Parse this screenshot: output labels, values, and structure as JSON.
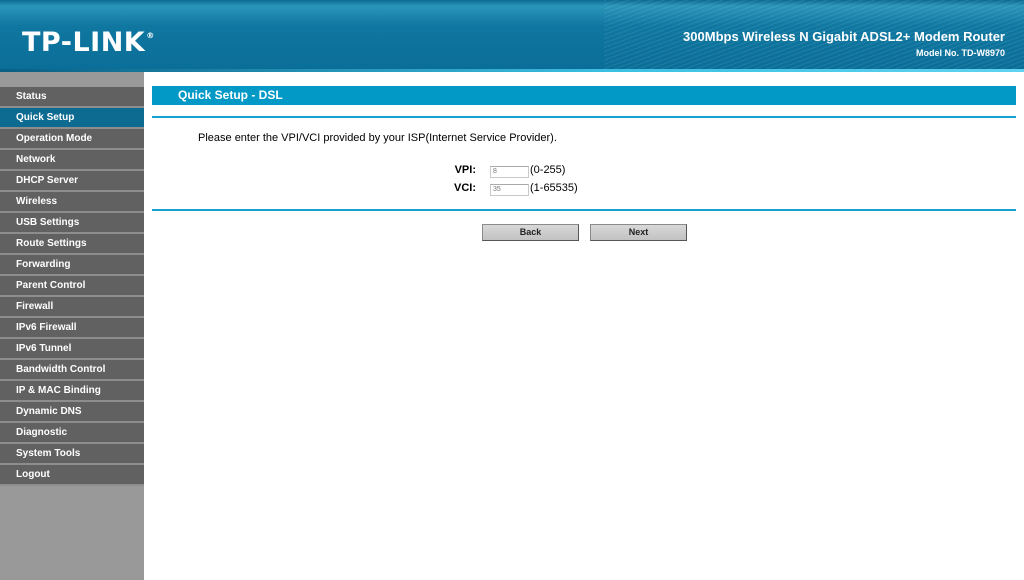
{
  "header": {
    "logo": "TP-LINK",
    "logo_mark": "®",
    "product_name": "300Mbps Wireless N Gigabit ADSL2+ Modem Router",
    "model": "Model No. TD-W8970"
  },
  "sidebar": {
    "active": "Quick Setup",
    "items": [
      {
        "label": "Status"
      },
      {
        "label": "Quick Setup"
      },
      {
        "label": "Operation Mode"
      },
      {
        "label": "Network"
      },
      {
        "label": "DHCP Server"
      },
      {
        "label": "Wireless"
      },
      {
        "label": "USB Settings"
      },
      {
        "label": "Route Settings"
      },
      {
        "label": "Forwarding"
      },
      {
        "label": "Parent Control"
      },
      {
        "label": "Firewall"
      },
      {
        "label": "IPv6 Firewall"
      },
      {
        "label": "IPv6 Tunnel"
      },
      {
        "label": "Bandwidth Control"
      },
      {
        "label": "IP & MAC Binding"
      },
      {
        "label": "Dynamic DNS"
      },
      {
        "label": "Diagnostic"
      },
      {
        "label": "System Tools"
      },
      {
        "label": "Logout"
      }
    ]
  },
  "main": {
    "title": "Quick Setup - DSL",
    "instruction": "Please enter the VPI/VCI provided by your ISP(Internet Service Provider).",
    "fields": {
      "vpi": {
        "label": "VPI:",
        "value": "8",
        "range": "(0-255)"
      },
      "vci": {
        "label": "VCI:",
        "value": "35",
        "range": "(1-65535)"
      }
    },
    "buttons": {
      "back": "Back",
      "next": "Next"
    }
  },
  "colors": {
    "header_blue": "#0a6e98",
    "title_bar": "#0399c7",
    "menu_item": "#616161",
    "menu_active": "#0d6b91",
    "sidebar_bg": "#999999"
  }
}
